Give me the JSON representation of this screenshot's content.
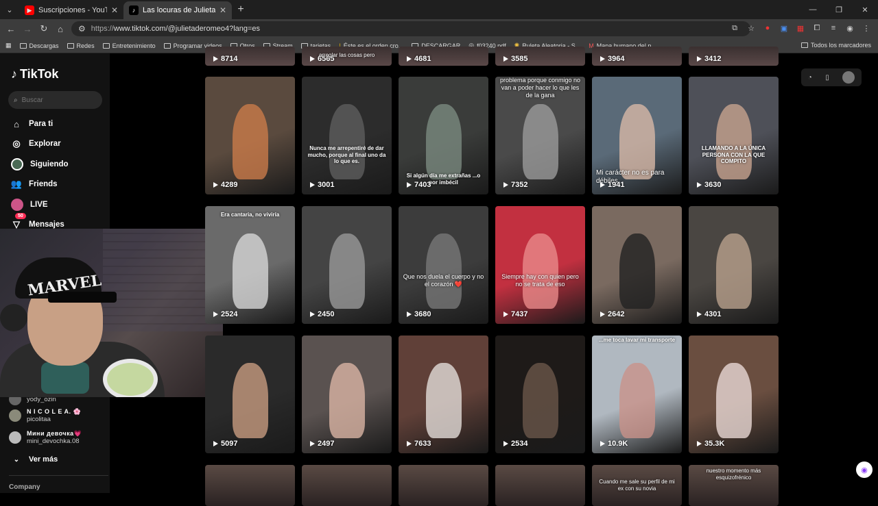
{
  "browser": {
    "tabs": [
      {
        "title": "Suscripciones - YouTube",
        "active": false
      },
      {
        "title": "Las locuras de Julieta (@julietad",
        "active": true
      }
    ],
    "url_prefix": "https://",
    "url": "www.tiktok.com/@julietaderomeo4?lang=es"
  },
  "bookmarks": [
    "Descargas",
    "Redes",
    "Entretenimiento",
    "Programar videos",
    "Otros",
    "Stream",
    "tarjetas",
    "Éste es el orden cro...",
    "DESCARGAR",
    "f03240.pdf",
    "Ruleta Aleatoria - S...",
    "Mapa humano del p..."
  ],
  "bookmarks_right": "Todos los marcadores",
  "sidebar": {
    "brand": "TikTok",
    "search_placeholder": "Buscar",
    "nav": [
      {
        "label": "Para ti",
        "icon": "home-icon"
      },
      {
        "label": "Explorar",
        "icon": "compass-icon"
      },
      {
        "label": "Siguiendo",
        "icon": "following-avatar-icon"
      },
      {
        "label": "Friends",
        "icon": "friends-icon"
      },
      {
        "label": "LIVE",
        "icon": "live-icon"
      },
      {
        "label": "Mensajes",
        "icon": "inbox-icon",
        "badge": "50"
      }
    ],
    "following": [
      {
        "name": "",
        "user": "yody_ozin"
      },
      {
        "name": "N I C O L E A. 🌸",
        "user": "picolitaa"
      },
      {
        "name": "Мини девочка💗",
        "user": "mini_devochka.08"
      }
    ],
    "see_more": "Ver más",
    "footer": "Company"
  },
  "webcam": {
    "cap_text": "MARVEL"
  },
  "videos_top_partial": [
    "8714",
    "6565",
    "4681",
    "3585",
    "3964",
    "3412"
  ],
  "videos_top_caption": "arreglar las cosas pero",
  "videos": [
    [
      {
        "views": "4289",
        "caption": ""
      },
      {
        "views": "3001",
        "caption": "Nunca me arrepentiré de dar mucho, porque al final uno da lo que es."
      },
      {
        "views": "7403",
        "caption": "Si algún día me extrañas ...o por imbécil"
      },
      {
        "views": "7352",
        "caption": "problema porque conmigo no van a poder hacer lo que les de la gana"
      },
      {
        "views": "1941",
        "caption": "Mi carácter no es para débiles."
      },
      {
        "views": "3630",
        "caption": "LLAMANDO A LA ÚNICA PERSONA CON LA QUE COMPITO"
      }
    ],
    [
      {
        "views": "2524",
        "caption": "Era cantaria, no viviría"
      },
      {
        "views": "2450",
        "caption": ""
      },
      {
        "views": "3680",
        "caption": "Que nos duela el cuerpo y no el corazón ❤️"
      },
      {
        "views": "7437",
        "caption": "Siempre hay con quien pero no se trata de eso"
      },
      {
        "views": "2642",
        "caption": ""
      },
      {
        "views": "4301",
        "caption": ""
      }
    ],
    [
      {
        "views": "5097",
        "caption": ""
      },
      {
        "views": "2497",
        "caption": ""
      },
      {
        "views": "7633",
        "caption": ""
      },
      {
        "views": "2534",
        "caption": ""
      },
      {
        "views": "10.9K",
        "caption": "...me toca lavar mi transporte"
      },
      {
        "views": "35.3K",
        "caption": ""
      }
    ]
  ],
  "videos_bottom_captions": [
    "",
    "",
    "",
    "",
    "Cuando me sale su perfil de mi ex con su novia",
    "nuestro momento más esquizofrénico"
  ],
  "colors": {
    "accent": "#fe2c55",
    "background": "#000000",
    "sidebar": "#121212"
  }
}
